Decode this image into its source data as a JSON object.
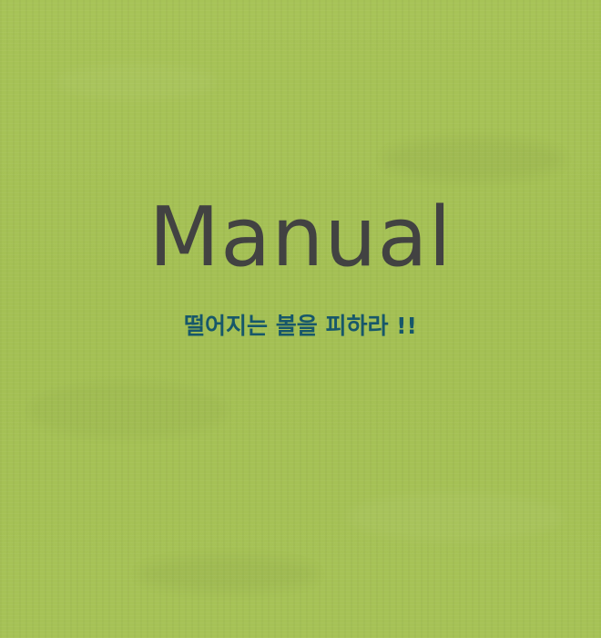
{
  "manual": {
    "title": "Manual",
    "instruction": "떨어지는 볼을 피하라 !!"
  },
  "colors": {
    "background": "#a5c155",
    "title": "#424242",
    "instruction": "#17576a"
  }
}
